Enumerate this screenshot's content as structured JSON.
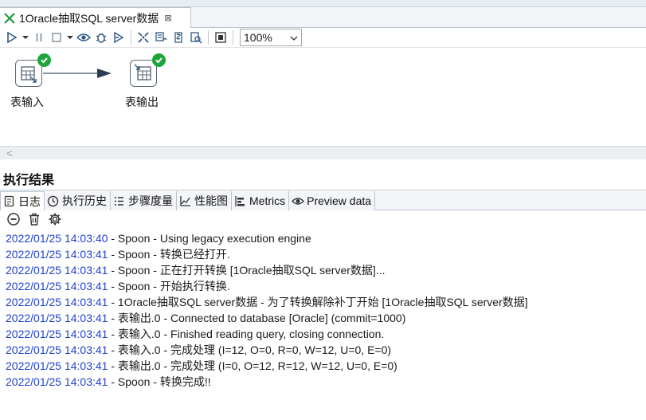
{
  "editor_tab": {
    "title": "1Oracle抽取SQL server数据",
    "close_glyph": "⊠"
  },
  "toolbar": {
    "zoom_value": "100%"
  },
  "canvas": {
    "steps": [
      {
        "label": "表输入",
        "status": "success"
      },
      {
        "label": "表输出",
        "status": "success"
      }
    ],
    "scroll_arrow": "<"
  },
  "results": {
    "title": "执行结果",
    "tabs": [
      {
        "label": "日志",
        "icon": "log-icon"
      },
      {
        "label": "执行历史",
        "icon": "history-icon"
      },
      {
        "label": "步骤度量",
        "icon": "step-metrics-icon"
      },
      {
        "label": "性能图",
        "icon": "performance-chart-icon"
      },
      {
        "label": "Metrics",
        "icon": "metrics-icon"
      },
      {
        "label": "Preview data",
        "icon": "preview-eye-icon"
      }
    ],
    "log_lines": [
      {
        "time": "2022/01/25 14:03:40",
        "msg": " - Spoon - Using legacy execution engine"
      },
      {
        "time": "2022/01/25 14:03:41",
        "msg": " - Spoon - 转换已经打开."
      },
      {
        "time": "2022/01/25 14:03:41",
        "msg": " - Spoon - 正在打开转换 [1Oracle抽取SQL server数据]..."
      },
      {
        "time": "2022/01/25 14:03:41",
        "msg": " - Spoon - 开始执行转换."
      },
      {
        "time": "2022/01/25 14:03:41",
        "msg": " - 1Oracle抽取SQL server数据 - 为了转换解除补丁开始  [1Oracle抽取SQL server数据]"
      },
      {
        "time": "2022/01/25 14:03:41",
        "msg": " - 表输出.0 - Connected to database [Oracle] (commit=1000)"
      },
      {
        "time": "2022/01/25 14:03:41",
        "msg": " - 表输入.0 - Finished reading query, closing connection."
      },
      {
        "time": "2022/01/25 14:03:41",
        "msg": " - 表输入.0 - 完成处理 (I=12, O=0, R=0, W=12, U=0, E=0)"
      },
      {
        "time": "2022/01/25 14:03:41",
        "msg": " - 表输出.0 - 完成处理 (I=0, O=12, R=12, W=12, U=0, E=0)"
      },
      {
        "time": "2022/01/25 14:03:41",
        "msg": " - Spoon - 转换完成!!"
      }
    ]
  },
  "colors": {
    "timestamp": "#1f3fcf",
    "success_badge": "#1ea53a",
    "toolbar_icon": "#2f5a86"
  }
}
